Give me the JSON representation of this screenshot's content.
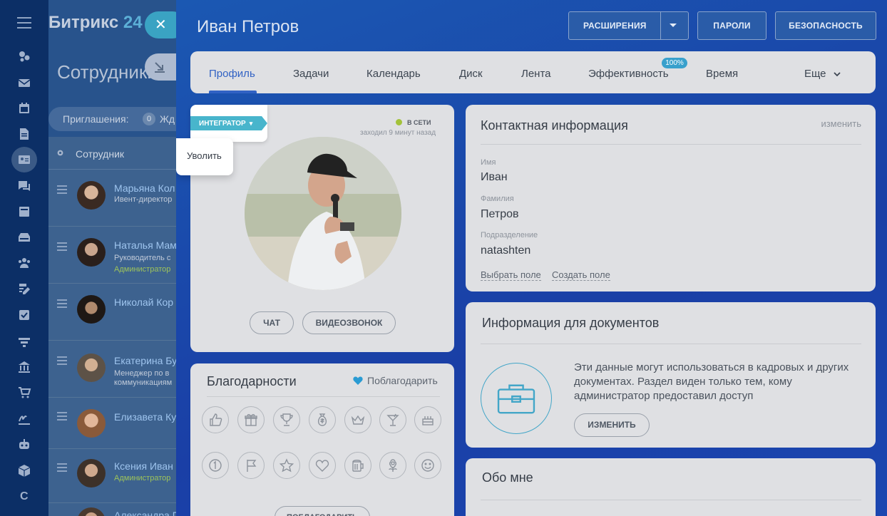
{
  "nav": {
    "icons": [
      "menu-icon",
      "activity-icon",
      "mail-icon",
      "calendar-icon",
      "document-icon",
      "employee-card-icon",
      "chat-icon",
      "news-icon",
      "drive-icon",
      "group-icon",
      "edit-icon",
      "tasks-icon",
      "funnel-icon",
      "bank-icon",
      "cart-icon",
      "signature-icon",
      "robot-icon",
      "box-icon"
    ],
    "bottom_letter": "C"
  },
  "background_page": {
    "logo_main": "Битрикс",
    "logo_num": "24",
    "close_symbol": "✕",
    "title": "Сотрудники",
    "invitations_label": "Приглашения:",
    "invitations_count": "0",
    "invitations_wait": "Жд",
    "column_header": "Сотрудник",
    "employees": [
      {
        "name": "Марьяна Кол",
        "position": "Ивент-директор",
        "role": ""
      },
      {
        "name": "Наталья Мам",
        "position": "Руководитель с",
        "role": "Администратор"
      },
      {
        "name": "Николай Кор",
        "position": "",
        "role": ""
      },
      {
        "name": "Екатерина Бу",
        "position": "Менеджер по в",
        "position2": "коммуникациям",
        "role": ""
      },
      {
        "name": "Елизавета Кур",
        "position": "",
        "role": ""
      },
      {
        "name": "Ксения Иван",
        "position": "",
        "role": "Администратор"
      },
      {
        "name": "Александра Г",
        "position": "",
        "role": ""
      }
    ]
  },
  "slider": {
    "title": "Иван Петров",
    "header_buttons": {
      "extensions": "Расширения",
      "passwords": "Пароли",
      "security": "Безопасность"
    },
    "tabs": [
      "Профиль",
      "Задачи",
      "Календарь",
      "Диск",
      "Лента",
      "Эффективность",
      "Время",
      "Еще"
    ],
    "efficiency_badge": "100%",
    "profile": {
      "role_tag": "Интегратор",
      "role_menu_item": "Уволить",
      "status": "в сети",
      "last_seen": "заходил 9 минут назад",
      "chat_button": "Чат",
      "video_button": "Видеозвонок"
    },
    "thanks": {
      "title": "Благодарности",
      "thank_link": "Поблагодарить",
      "button": "Поблагодарить",
      "awards": [
        "thumbs-up-icon",
        "gift-icon",
        "trophy-icon",
        "money-bag-icon",
        "crown-icon",
        "cocktail-icon",
        "cake-icon",
        "number-one-icon",
        "flag-icon",
        "star-icon",
        "heart-icon",
        "beer-icon",
        "flower-icon",
        "smile-icon"
      ]
    },
    "contact": {
      "title": "Контактная информация",
      "edit": "изменить",
      "first_name_label": "Имя",
      "first_name": "Иван",
      "last_name_label": "Фамилия",
      "last_name": "Петров",
      "department_label": "Подразделение",
      "department": "natashten",
      "choose_field": "Выбрать поле",
      "create_field": "Создать поле"
    },
    "documents": {
      "title": "Информация для документов",
      "text": "Эти данные могут использоваться в кадровых и других документах. Раздел виден только тем, кому администратор предоставил доступ",
      "button": "Изменить"
    },
    "about": {
      "title": "Обо мне"
    }
  },
  "colors": {
    "accent": "#3162c4",
    "online": "#a3c23a",
    "tag": "#48b5cc",
    "badge": "#38a0cc",
    "admin": "#9dc35a"
  }
}
